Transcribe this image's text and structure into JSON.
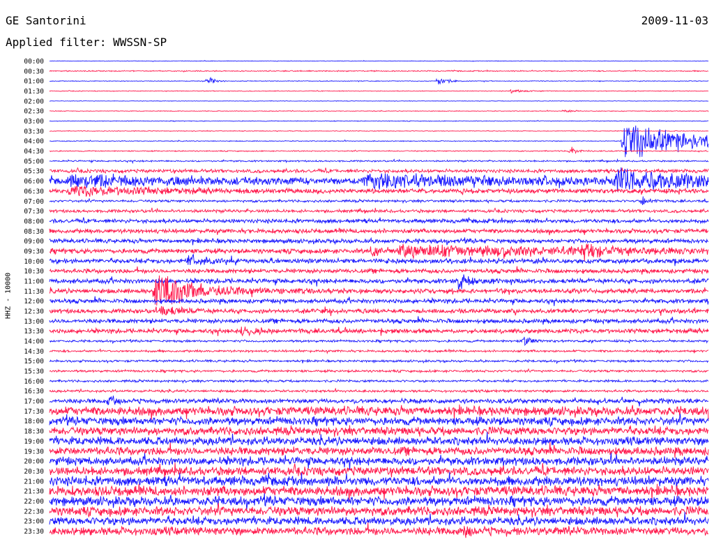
{
  "header": {
    "station": "GE Santorini",
    "filter": "Applied filter: WWSSN-SP",
    "date": "2009-11-03"
  },
  "chart_data": {
    "type": "seismogram",
    "channel_label": "HHZ - 10000",
    "colors": [
      "#1a1aff",
      "#ff1a4d"
    ],
    "row_labels": [
      "00:00",
      "00:30",
      "01:00",
      "01:30",
      "02:00",
      "02:30",
      "03:00",
      "03:30",
      "04:00",
      "04:30",
      "05:00",
      "05:30",
      "06:00",
      "06:30",
      "07:00",
      "07:30",
      "08:00",
      "08:30",
      "09:00",
      "09:30",
      "10:00",
      "10:30",
      "11:00",
      "11:30",
      "12:00",
      "12:30",
      "13:00",
      "13:30",
      "14:00",
      "14:30",
      "15:00",
      "15:30",
      "16:00",
      "16:30",
      "17:00",
      "17:30",
      "18:00",
      "18:30",
      "19:00",
      "19:30",
      "20:00",
      "20:30",
      "21:00",
      "21:30",
      "22:00",
      "22:30",
      "23:00",
      "23:30"
    ],
    "noise_level": [
      0.3,
      0.6,
      0.4,
      0.4,
      0.3,
      0.4,
      0.4,
      0.4,
      0.5,
      0.6,
      0.9,
      2.0,
      3.5,
      2.5,
      1.4,
      1.8,
      2.2,
      2.4,
      2.4,
      2.6,
      2.6,
      2.4,
      2.6,
      2.6,
      2.4,
      2.4,
      2.4,
      2.4,
      1.3,
      1.3,
      1.3,
      1.3,
      1.3,
      1.4,
      2.5,
      5.0,
      4.5,
      4.5,
      4.5,
      4.5,
      4.5,
      4.8,
      5.2,
      5.5,
      5.2,
      5.0,
      4.5,
      4.5
    ],
    "events": [
      {
        "row": 2,
        "pos": 0.24,
        "amp": 8,
        "dur": 0.01
      },
      {
        "row": 2,
        "pos": 0.59,
        "amp": 8,
        "dur": 0.012
      },
      {
        "row": 3,
        "pos": 0.7,
        "amp": 3,
        "dur": 0.02
      },
      {
        "row": 5,
        "pos": 0.78,
        "amp": 3,
        "dur": 0.01
      },
      {
        "row": 8,
        "pos": 0.87,
        "amp": 34,
        "dur": 0.11
      },
      {
        "row": 9,
        "pos": 0.79,
        "amp": 8,
        "dur": 0.01
      },
      {
        "row": 12,
        "pos": 0.03,
        "amp": 10,
        "dur": 0.14
      },
      {
        "row": 12,
        "pos": 0.48,
        "amp": 10,
        "dur": 0.26
      },
      {
        "row": 12,
        "pos": 0.86,
        "amp": 16,
        "dur": 0.12
      },
      {
        "row": 13,
        "pos": 0.03,
        "amp": 8,
        "dur": 0.12
      },
      {
        "row": 14,
        "pos": 0.9,
        "amp": 10,
        "dur": 0.01
      },
      {
        "row": 19,
        "pos": 0.53,
        "amp": 10,
        "dur": 0.26
      },
      {
        "row": 19,
        "pos": 0.49,
        "amp": 16,
        "dur": 0.01
      },
      {
        "row": 19,
        "pos": 0.81,
        "amp": 14,
        "dur": 0.02
      },
      {
        "row": 20,
        "pos": 0.21,
        "amp": 10,
        "dur": 0.02
      },
      {
        "row": 22,
        "pos": 0.62,
        "amp": 12,
        "dur": 0.02
      },
      {
        "row": 23,
        "pos": 0.16,
        "amp": 30,
        "dur": 0.06
      },
      {
        "row": 25,
        "pos": 0.17,
        "amp": 8,
        "dur": 0.03
      },
      {
        "row": 27,
        "pos": 0.29,
        "amp": 8,
        "dur": 0.03
      },
      {
        "row": 28,
        "pos": 0.72,
        "amp": 8,
        "dur": 0.01
      },
      {
        "row": 34,
        "pos": 0.09,
        "amp": 10,
        "dur": 0.01
      },
      {
        "row": 47,
        "pos": 0.63,
        "amp": 9,
        "dur": 0.01
      }
    ]
  }
}
